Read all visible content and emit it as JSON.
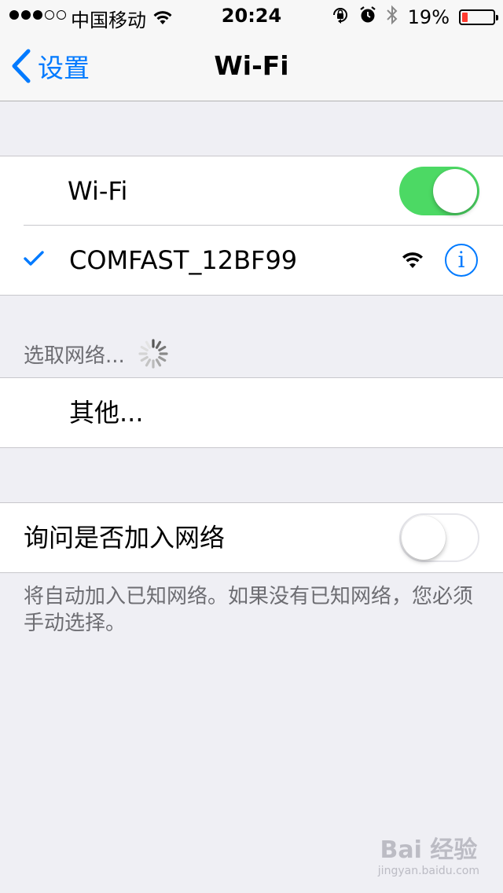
{
  "status_bar": {
    "carrier": "中国移动",
    "time": "20:24",
    "battery_percent": "19%",
    "battery_level": 0.19,
    "signal_bars_filled": 3,
    "signal_bars_total": 5,
    "battery_color": "#ff3b30"
  },
  "nav": {
    "back_label": "设置",
    "title": "Wi-Fi"
  },
  "wifi_group": {
    "wifi_label": "Wi-Fi",
    "wifi_enabled": true,
    "connected_network": "COMFAST_12BF99",
    "info_icon": "i"
  },
  "networks": {
    "header": "选取网络...",
    "other_label": "其他..."
  },
  "ask_join": {
    "label": "询问是否加入网络",
    "enabled": false,
    "footer": "将自动加入已知网络。如果没有已知网络，您必须手动选择。"
  },
  "watermark": {
    "text": "Bai 经验",
    "sub": "jingyan.baidu.com"
  },
  "colors": {
    "accent": "#007aff",
    "toggle_on": "#4cd964",
    "background": "#efeff4"
  }
}
